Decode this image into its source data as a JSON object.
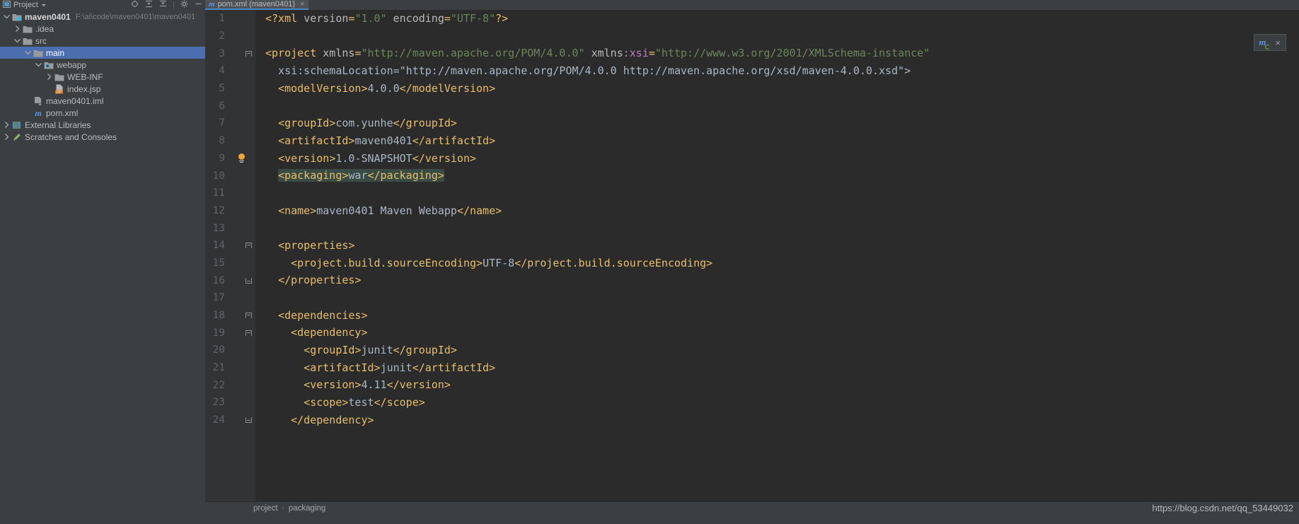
{
  "window": {
    "theme_bg": "#3c3f41",
    "editor_bg": "#2b2b2b",
    "accent": "#4b6eaf"
  },
  "tool_window": {
    "title": "Project",
    "dropdown_icon": "chevron-down-icon",
    "icons": [
      {
        "name": "locate-icon",
        "glyph": "target"
      },
      {
        "name": "expand-all-icon",
        "glyph": "expand"
      },
      {
        "name": "collapse-all-icon",
        "glyph": "collapse"
      },
      {
        "name": "settings-gear-icon",
        "glyph": "gear"
      },
      {
        "name": "hide-window-icon",
        "glyph": "minus"
      }
    ]
  },
  "project_tree": {
    "items": [
      {
        "label": "maven0401",
        "path_hint": "F:\\ai\\code\\maven0401\\maven0401",
        "icon": "module-folder-icon",
        "arrow": "expanded",
        "indent": 0,
        "bold": true,
        "selected": false
      },
      {
        "label": ".idea",
        "icon": "folder-icon",
        "arrow": "collapsed",
        "indent": 1,
        "bold": false,
        "selected": false
      },
      {
        "label": "src",
        "icon": "folder-icon",
        "arrow": "expanded",
        "indent": 1,
        "bold": false,
        "selected": false
      },
      {
        "label": "main",
        "icon": "folder-icon",
        "arrow": "expanded",
        "indent": 2,
        "bold": false,
        "selected": true
      },
      {
        "label": "webapp",
        "icon": "web-resource-folder-icon",
        "arrow": "expanded",
        "indent": 3,
        "bold": false,
        "selected": false
      },
      {
        "label": "WEB-INF",
        "icon": "folder-icon",
        "arrow": "collapsed",
        "indent": 4,
        "bold": false,
        "selected": false
      },
      {
        "label": "index.jsp",
        "icon": "jsp-file-icon",
        "arrow": "none",
        "indent": 4,
        "bold": false,
        "selected": false
      },
      {
        "label": "maven0401.iml",
        "icon": "iml-file-icon",
        "arrow": "none",
        "indent": 2,
        "bold": false,
        "selected": false
      },
      {
        "label": "pom.xml",
        "icon": "maven-pom-icon",
        "arrow": "none",
        "indent": 2,
        "bold": false,
        "selected": false
      },
      {
        "label": "External Libraries",
        "icon": "external-libraries-icon",
        "arrow": "collapsed",
        "indent": 0,
        "bold": false,
        "selected": false
      },
      {
        "label": "Scratches and Consoles",
        "icon": "scratches-icon",
        "arrow": "collapsed",
        "indent": 0,
        "bold": false,
        "selected": false
      }
    ]
  },
  "editor": {
    "tab": {
      "label": "pom.xml (maven0401)",
      "icon": "maven-pom-icon",
      "close_icon": "close-icon",
      "active": true
    },
    "lines": [
      {
        "num": "1",
        "fold": "none",
        "annot": "none"
      },
      {
        "num": "2",
        "fold": "none",
        "annot": "none"
      },
      {
        "num": "3",
        "fold": "open",
        "annot": "none"
      },
      {
        "num": "4",
        "fold": "none",
        "annot": "none"
      },
      {
        "num": "5",
        "fold": "none",
        "annot": "none"
      },
      {
        "num": "6",
        "fold": "none",
        "annot": "none"
      },
      {
        "num": "7",
        "fold": "none",
        "annot": "none"
      },
      {
        "num": "8",
        "fold": "none",
        "annot": "none"
      },
      {
        "num": "9",
        "fold": "none",
        "annot": "bulb"
      },
      {
        "num": "10",
        "fold": "none",
        "annot": "none"
      },
      {
        "num": "11",
        "fold": "none",
        "annot": "none"
      },
      {
        "num": "12",
        "fold": "none",
        "annot": "none"
      },
      {
        "num": "13",
        "fold": "none",
        "annot": "none"
      },
      {
        "num": "14",
        "fold": "open",
        "annot": "none"
      },
      {
        "num": "15",
        "fold": "none",
        "annot": "none"
      },
      {
        "num": "16",
        "fold": "close",
        "annot": "none"
      },
      {
        "num": "17",
        "fold": "none",
        "annot": "none"
      },
      {
        "num": "18",
        "fold": "open",
        "annot": "none"
      },
      {
        "num": "19",
        "fold": "open",
        "annot": "none"
      },
      {
        "num": "20",
        "fold": "none",
        "annot": "none"
      },
      {
        "num": "21",
        "fold": "none",
        "annot": "none"
      },
      {
        "num": "22",
        "fold": "none",
        "annot": "none"
      },
      {
        "num": "23",
        "fold": "none",
        "annot": "none"
      },
      {
        "num": "24",
        "fold": "close",
        "annot": "none"
      }
    ],
    "code_text": [
      "<?xml version=\"1.0\" encoding=\"UTF-8\"?>",
      "",
      "<project xmlns=\"http://maven.apache.org/POM/4.0.0\" xmlns:xsi=\"http://www.w3.org/2001/XMLSchema-instance\"",
      "  xsi:schemaLocation=\"http://maven.apache.org/POM/4.0.0 http://maven.apache.org/xsd/maven-4.0.0.xsd\">",
      "  <modelVersion>4.0.0</modelVersion>",
      "",
      "  <groupId>com.yunhe</groupId>",
      "  <artifactId>maven0401</artifactId>",
      "  <version>1.0-SNAPSHOT</version>",
      "  <packaging>war</packaging>",
      "",
      "  <name>maven0401 Maven Webapp</name>",
      "",
      "  <properties>",
      "    <project.build.sourceEncoding>UTF-8</project.build.sourceEncoding>",
      "  </properties>",
      "",
      "  <dependencies>",
      "    <dependency>",
      "      <groupId>junit</groupId>",
      "      <artifactId>junit</artifactId>",
      "      <version>4.11</version>",
      "      <scope>test</scope>",
      "    </dependency>"
    ],
    "selected_line": 10,
    "selection_text": "<packaging>war</packaging>"
  },
  "breadcrumb": {
    "items": [
      "project",
      "packaging"
    ],
    "separator": "›"
  },
  "maven_popup": {
    "icon": "maven-reimport-icon",
    "close_icon": "close-icon"
  },
  "watermark": {
    "text": "https://blog.csdn.net/qq_53449032"
  }
}
